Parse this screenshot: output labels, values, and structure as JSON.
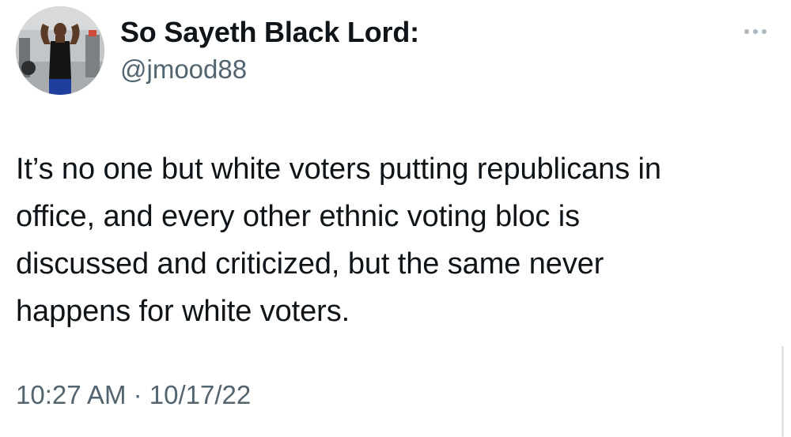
{
  "author": {
    "display_name": "So Sayeth Black Lord:",
    "handle": "@jmood88"
  },
  "tweet": {
    "text": "It’s no one but white voters putting republicans in\noffice, and every other ethnic voting bloc is\ndiscussed and criticized, but the same never\nhappens for white voters.",
    "time": "10:27 AM",
    "separator": "·",
    "date": "10/17/22"
  },
  "icons": {
    "more": "more-options-icon",
    "avatar": "profile-photo"
  },
  "colors": {
    "text": "#0f1419",
    "secondary": "#536471",
    "dots": "#aab8c2"
  }
}
